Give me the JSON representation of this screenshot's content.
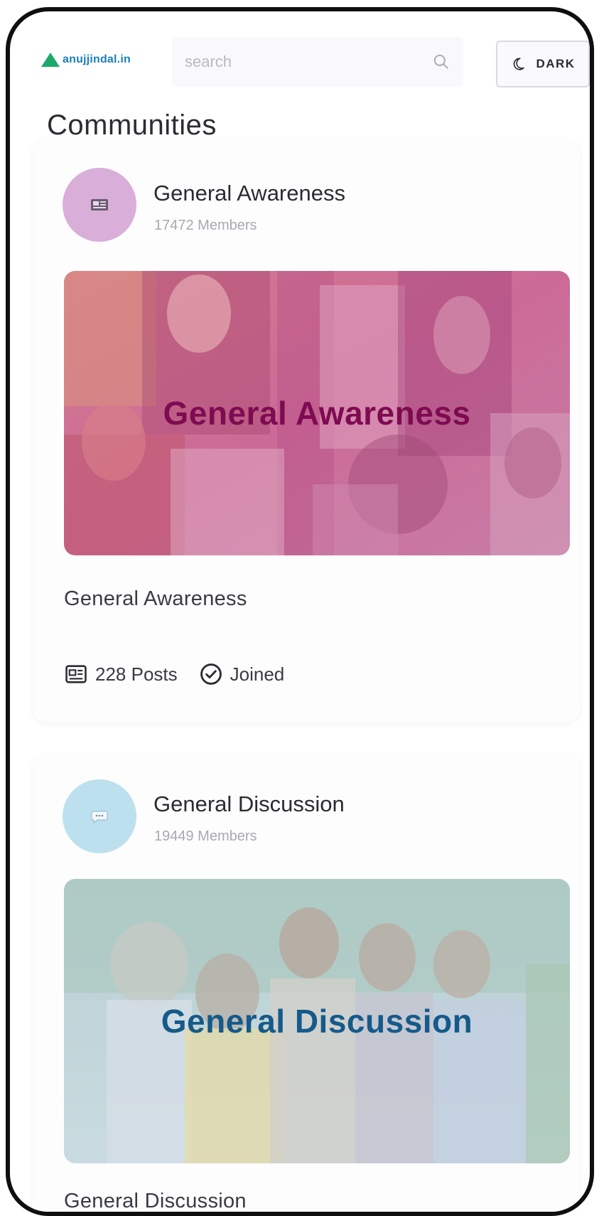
{
  "header": {
    "brand": "anujjindal.in",
    "search_placeholder": "search",
    "dark_label": "DARK"
  },
  "page": {
    "title": "Communities"
  },
  "communities": [
    {
      "name": "General Awareness",
      "members": "17472 Members",
      "banner_title": "General Awareness",
      "description": "General Awareness",
      "posts": "228 Posts",
      "status": "Joined",
      "accent": "#7e0b52"
    },
    {
      "name": "General Discussion",
      "members": "19449 Members",
      "banner_title": "General Discussion",
      "description": "General Discussion",
      "accent": "#155a8a"
    }
  ]
}
